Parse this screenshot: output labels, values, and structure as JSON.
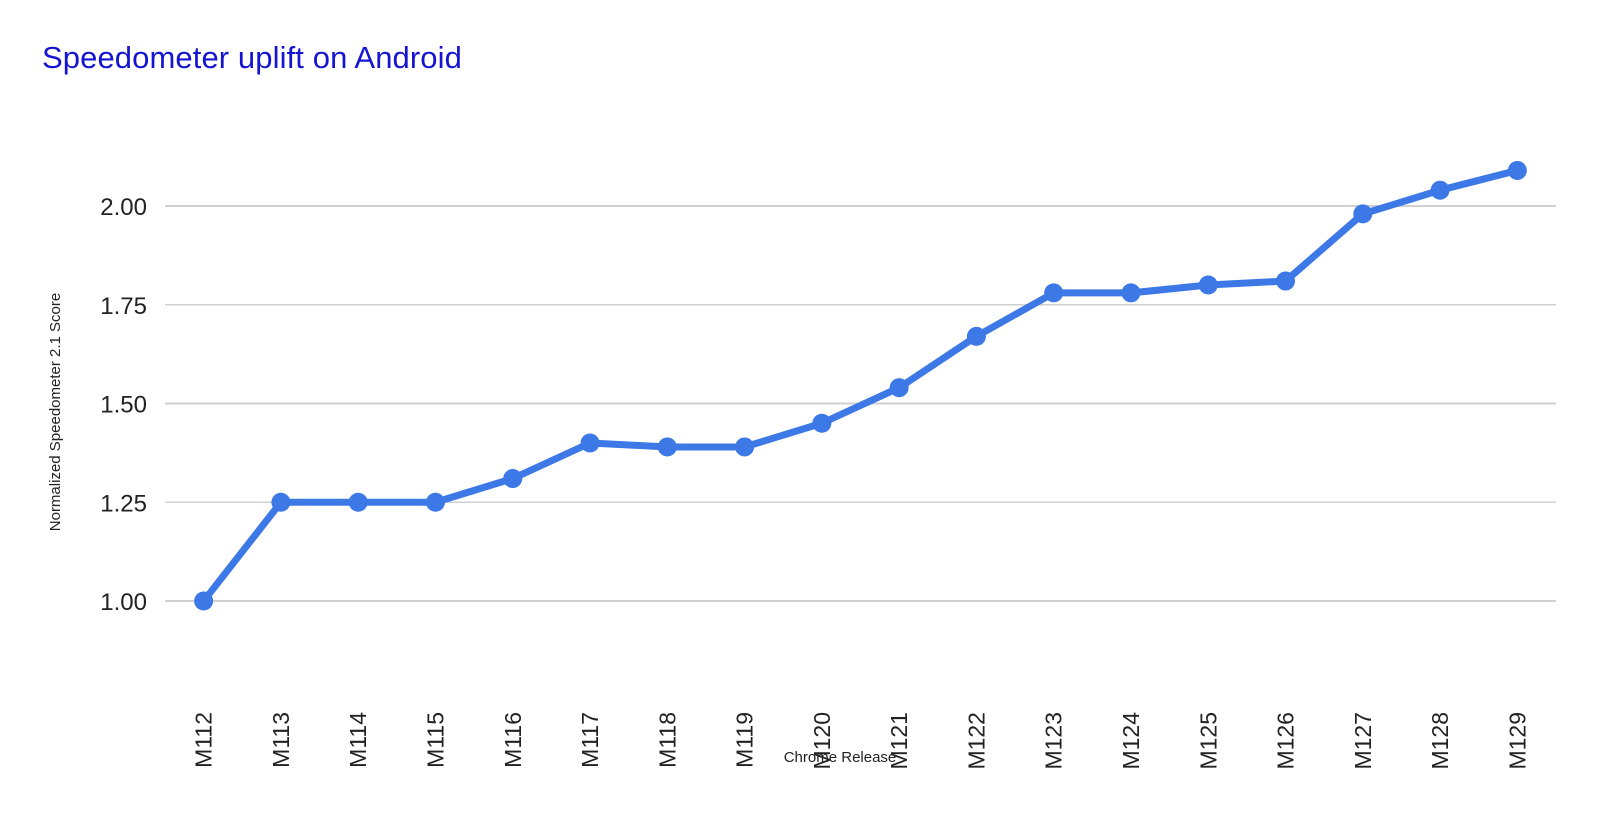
{
  "chart_data": {
    "type": "line",
    "title": "Speedometer uplift on Android",
    "xlabel": "Chrome Release",
    "ylabel": "Normalized Speedometer 2.1 Score",
    "categories": [
      "M112",
      "M113",
      "M114",
      "M115",
      "M116",
      "M117",
      "M118",
      "M119",
      "M120",
      "M121",
      "M122",
      "M123",
      "M124",
      "M125",
      "M126",
      "M127",
      "M128",
      "M129"
    ],
    "values": [
      1.0,
      1.25,
      1.25,
      1.25,
      1.31,
      1.4,
      1.39,
      1.39,
      1.45,
      1.54,
      1.67,
      1.78,
      1.78,
      1.8,
      1.81,
      1.98,
      2.04,
      2.09
    ],
    "series": [
      {
        "name": "Normalized Speedometer 2.1 Score",
        "values": [
          1.0,
          1.25,
          1.25,
          1.25,
          1.31,
          1.4,
          1.39,
          1.39,
          1.45,
          1.54,
          1.67,
          1.78,
          1.78,
          1.8,
          1.81,
          1.98,
          2.04,
          2.09
        ]
      }
    ],
    "ytick_labels": [
      "1.00",
      "1.25",
      "1.50",
      "1.75",
      "2.00"
    ],
    "ytick_values": [
      1.0,
      1.25,
      1.5,
      1.75,
      2.0
    ],
    "ylim": [
      0.97,
      2.12
    ],
    "grid": "horizontal",
    "legend": "none",
    "series_color": "#3c78e6",
    "title_color": "#1414d2",
    "gridline_color": "#d0d0d0",
    "axis_text_color": "#222222",
    "background_color": "#ffffff",
    "x_tick_rotation_deg": -90
  },
  "title": {
    "text": "Speedometer uplift on Android"
  },
  "axes": {
    "x_axis_title": "Chrome Release",
    "y_axis_title": "Normalized Speedometer 2.1 Score"
  }
}
